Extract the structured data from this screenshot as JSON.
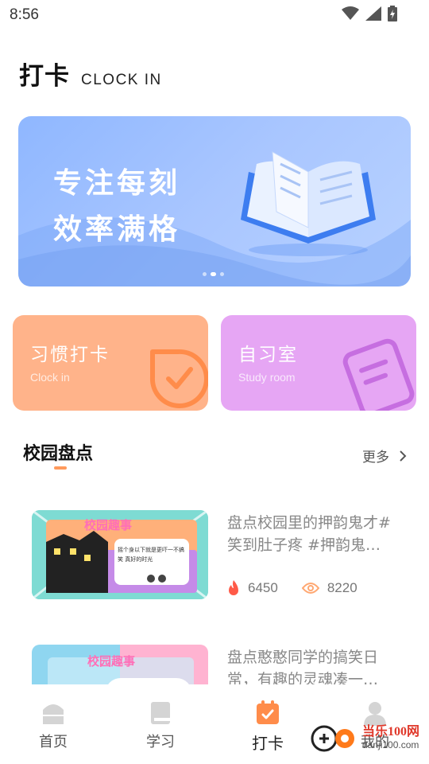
{
  "status_bar": {
    "time": "8:56",
    "icons": [
      "wifi-icon",
      "signal-icon",
      "battery-icon"
    ]
  },
  "header": {
    "title": "打卡",
    "subtitle": "CLOCK IN"
  },
  "banner": {
    "line1": "专注每刻",
    "line2": "效率满格",
    "dots": 3,
    "active_dot": 2
  },
  "cards": [
    {
      "title": "习惯打卡",
      "subtitle": "Clock in",
      "color": "#ffb38a",
      "icon": "check-badge-icon"
    },
    {
      "title": "自习室",
      "subtitle": "Study room",
      "color": "#e6a6f4",
      "icon": "notebook-icon"
    }
  ],
  "section": {
    "title": "校园盘点",
    "more_label": "更多"
  },
  "articles": [
    {
      "title": "盘点校园里的押韵鬼才#笑到肚子疼 #押韵鬼…",
      "likes": "6450",
      "views": "8220",
      "thumb_label": "校园趣事",
      "thumb_note": "摇个身以下就是更吓一不搞笑 真好的时光"
    },
    {
      "title": "盘点憨憨同学的搞笑日常，有趣的灵魂凑一…",
      "thumb_label": "校园趣事"
    }
  ],
  "nav": [
    {
      "label": "首页",
      "icon": "home-icon"
    },
    {
      "label": "学习",
      "icon": "book-icon"
    },
    {
      "label": "打卡",
      "icon": "calendar-check-icon",
      "active": true
    },
    {
      "label": "我的",
      "icon": "user-icon"
    }
  ],
  "watermark": {
    "top": "当乐100网",
    "bottom": "danji100.com"
  },
  "colors": {
    "accent": "#ff9a5c",
    "banner": "#8fb7ff",
    "habit": "#ffb38a",
    "study": "#e6a6f4"
  }
}
